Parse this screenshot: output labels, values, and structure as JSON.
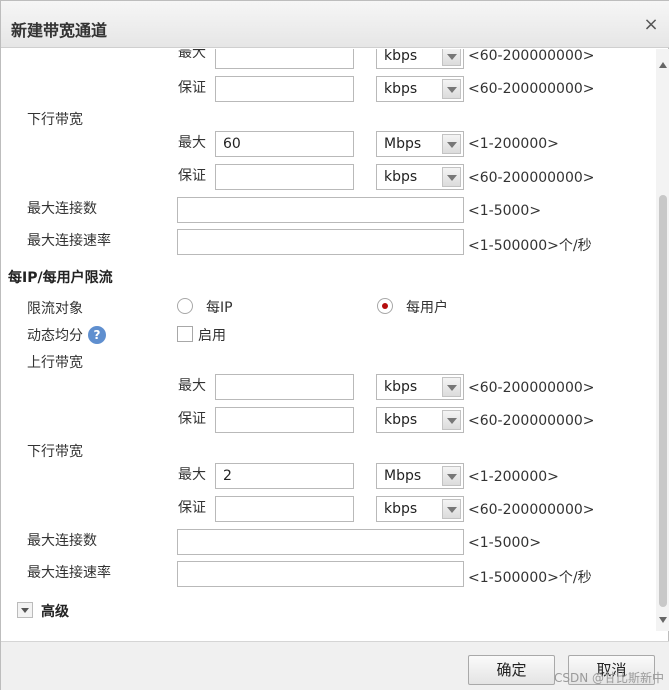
{
  "dialog": {
    "title": "新建带宽通道",
    "close_glyph": "×"
  },
  "labels": {
    "max": "最大",
    "guarantee": "保证",
    "downlink": "下行带宽",
    "uplink": "上行带宽",
    "max_connections": "最大连接数",
    "max_conn_rate": "最大连接速率",
    "per_ip_section": "每IP/每用户限流",
    "limit_target": "限流对象",
    "per_ip": "每IP",
    "per_user": "每用户",
    "dynamic_average": "动态均分",
    "enable": "启用",
    "advanced": "高级",
    "help_glyph": "?"
  },
  "units": {
    "kbps": "kbps",
    "mbps": "Mbps"
  },
  "hints": {
    "range_kbps": "<60-200000000>",
    "range_mbps": "<1-200000>",
    "range_conn": "<1-5000>",
    "range_rate": "<1-500000>个/秒"
  },
  "values": {
    "top_max": "",
    "top_guarantee": "",
    "down_max": "60",
    "down_guarantee": "",
    "max_conn": "",
    "max_conn_rate": "",
    "per_up_max": "",
    "per_up_guarantee": "",
    "per_down_max": "2",
    "per_down_guarantee": "",
    "per_max_conn": "",
    "per_max_conn_rate": ""
  },
  "limit_target_selected": "每用户",
  "dynamic_average_enabled": false,
  "buttons": {
    "ok": "确定",
    "cancel": "取消"
  },
  "watermark": "CSDN @甘比斯新中",
  "colors": {
    "radio_selected": "#b50e0e",
    "help_icon": "#5f8fcf"
  }
}
